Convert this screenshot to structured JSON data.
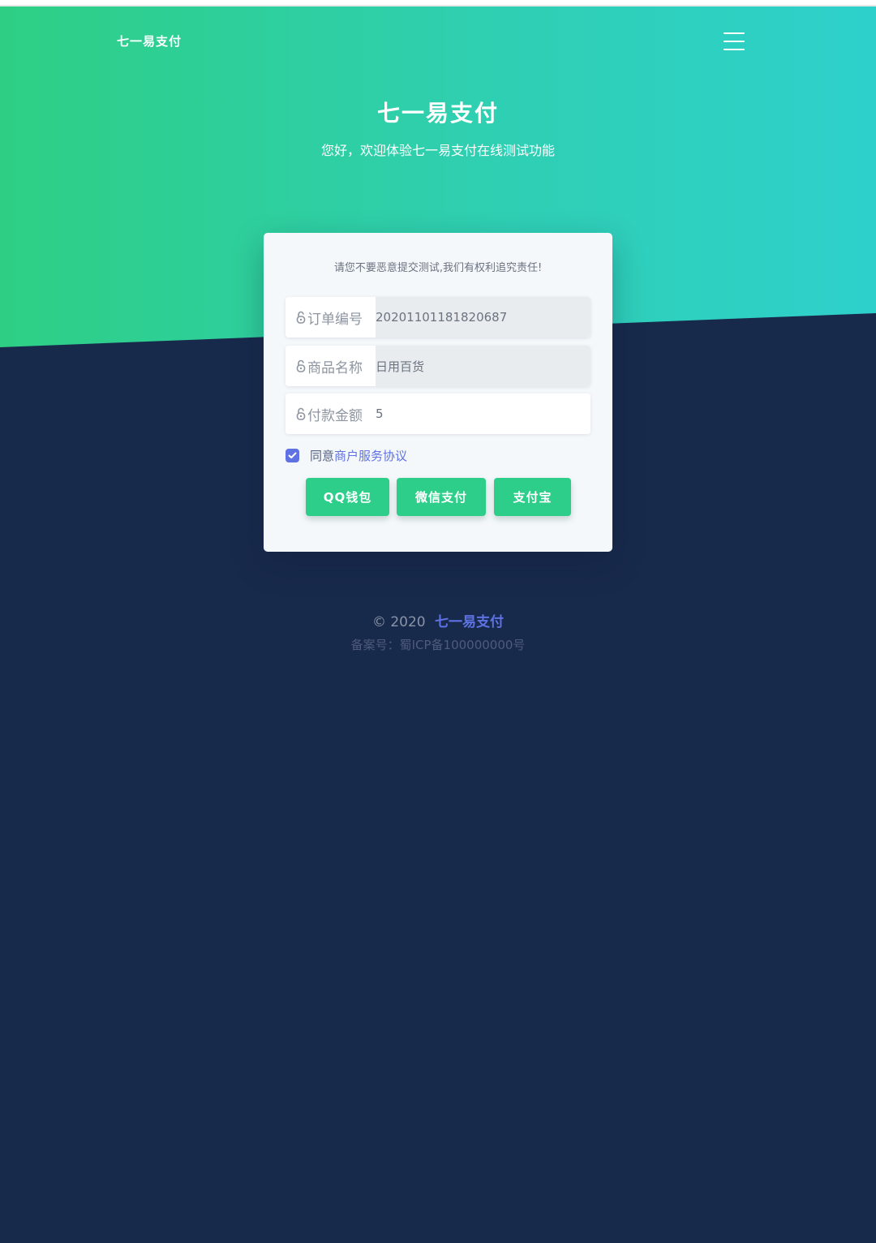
{
  "header": {
    "brand": "七一易支付",
    "menu_icon": "hamburger-menu-icon"
  },
  "hero": {
    "title": "七一易支付",
    "subtitle": "您好，欢迎体验七一易支付在线测试功能"
  },
  "form": {
    "warning": "请您不要恶意提交测试,我们有权利追究责任!",
    "fields": [
      {
        "label": "订单编号",
        "value": "20201101181820687",
        "icon": "lock-icon"
      },
      {
        "label": "商品名称",
        "value": "日用百货",
        "icon": "lock-icon"
      },
      {
        "label": "付款金额",
        "value": "5",
        "icon": "lock-icon"
      }
    ],
    "agree_text": "同意",
    "agree_link": "商户服务协议",
    "agree_checked": true,
    "buttons": [
      {
        "label": "QQ钱包"
      },
      {
        "label": "微信支付"
      },
      {
        "label": "支付宝"
      }
    ]
  },
  "footer": {
    "copyright": "© 2020",
    "brand": "七一易支付",
    "icp": "备案号：蜀ICP备100000000号"
  },
  "colors": {
    "hero_gradient_start": "#2ecf84",
    "hero_gradient_end": "#2ed0cc",
    "background": "#182a4c",
    "button": "#2dce89",
    "accent": "#5e72e4"
  }
}
